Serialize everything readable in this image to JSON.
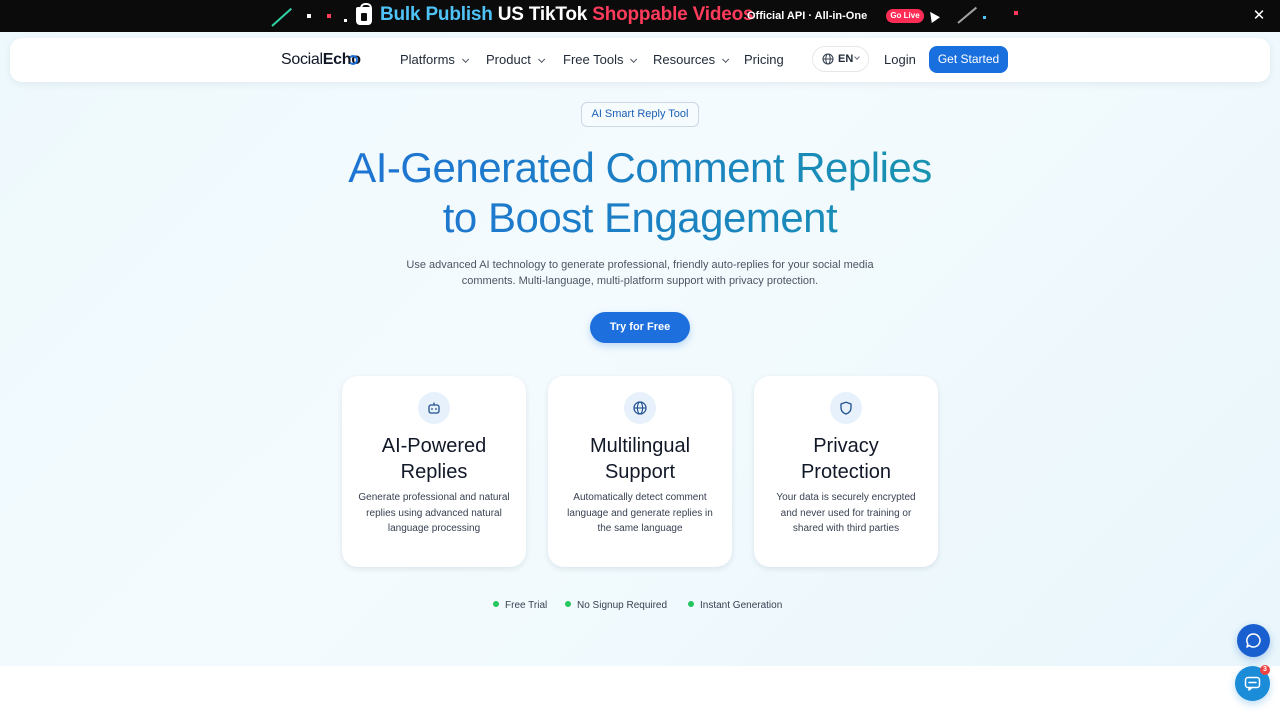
{
  "promo": {
    "headline_part1": "Bulk Publish",
    "headline_part2": "US TikTok",
    "headline_part3": "Shoppable Videos",
    "subtext": "Official API · All-in-One",
    "live_badge": "Go Live",
    "close_symbol": "✕",
    "colors": {
      "cyan": "#4fc3f7",
      "pink": "#ff3b5c",
      "background": "#0b0b0c"
    }
  },
  "navbar": {
    "logo_part1": "Social",
    "logo_part2": "Echo",
    "menu": [
      {
        "label": "Platforms"
      },
      {
        "label": "Product"
      },
      {
        "label": "Free Tools"
      },
      {
        "label": "Resources"
      },
      {
        "label": "Pricing"
      }
    ],
    "language": "EN",
    "login_label": "Login",
    "get_started_label": "Get Started",
    "accent": "#1a6fdf"
  },
  "hero": {
    "badge": "AI Smart Reply Tool",
    "title_line1": "AI-Generated Comment Replies",
    "title_line2": "to Boost Engagement",
    "description_line1": "Use advanced AI technology to generate professional, friendly auto-replies for your social media",
    "description_line2": "comments. Multi-language, multi-platform support with privacy protection.",
    "cta_label": "Try for Free"
  },
  "features": [
    {
      "icon": "robot-icon",
      "title_line1": "AI-Powered",
      "title_line2": "Replies",
      "description": "Generate professional and natural replies using advanced natural language processing"
    },
    {
      "icon": "globe-icon",
      "title_line1": "Multilingual",
      "title_line2": "Support",
      "description": "Automatically detect comment language and generate replies in the same language"
    },
    {
      "icon": "shield-icon",
      "title_line1": "Privacy",
      "title_line2": "Protection",
      "description": "Your data is securely encrypted and never used for training or shared with third parties"
    }
  ],
  "trust": [
    {
      "label": "Free Trial"
    },
    {
      "label": "No Signup Required"
    },
    {
      "label": "Instant Generation"
    }
  ],
  "floating": {
    "chat_icon": "chat-bubble-icon",
    "support_icon": "support-chat-icon",
    "support_count": "3"
  }
}
